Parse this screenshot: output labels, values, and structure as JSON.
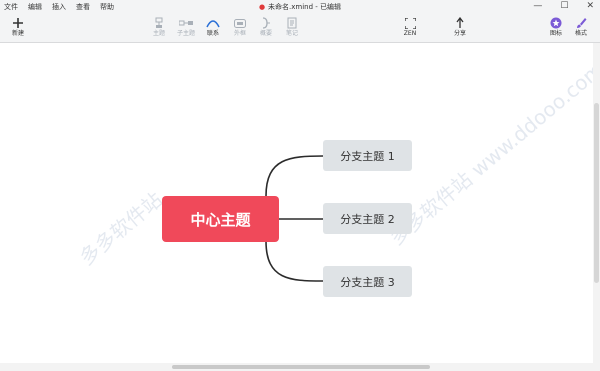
{
  "menu": [
    "文件",
    "编辑",
    "插入",
    "查看",
    "帮助"
  ],
  "document": {
    "title": "未命名.xmind - 已编辑",
    "unsaved_color": "#e03a3a"
  },
  "window_controls": {
    "minimize": "—",
    "maximize": "☐",
    "close": "✕"
  },
  "toolbar": {
    "new": "新建",
    "topic": "主题",
    "subtopic": "子主题",
    "relationship": "联系",
    "boundary": "外框",
    "summary": "概要",
    "note": "笔记",
    "zen": "ZEN",
    "share": "分享",
    "icon": "图标",
    "format": "格式"
  },
  "mindmap": {
    "central": "中心主题",
    "branches": [
      "分支主题 1",
      "分支主题 2",
      "分支主题 3"
    ],
    "central_color": "#f0495a",
    "branch_color": "#dfe3e6"
  },
  "watermark": {
    "left": "多多软件站",
    "right": "多多软件站 www.ddooo.com"
  }
}
